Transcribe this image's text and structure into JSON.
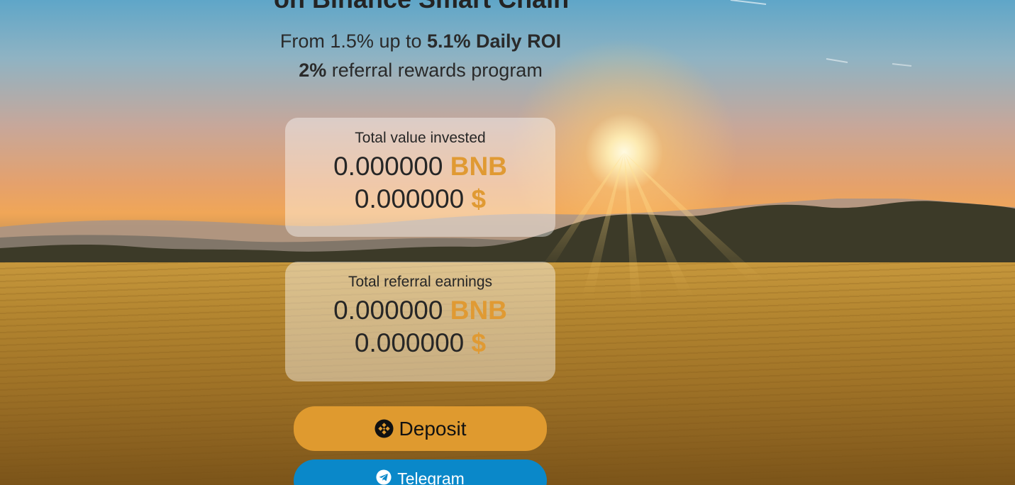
{
  "hero": {
    "headline": "on Binance Smart Chain",
    "line1_prefix": "From 1.5% up to ",
    "line1_bold": "5.1% Daily ROI",
    "line2_bold": "2%",
    "line2_suffix": " referral rewards program"
  },
  "stats": {
    "invested": {
      "title": "Total value invested",
      "bnb_value": "0.000000",
      "bnb_unit": "BNB",
      "usd_value": "0.000000",
      "usd_unit": "$"
    },
    "referral": {
      "title": "Total referral earnings",
      "bnb_value": "0.000000",
      "bnb_unit": "BNB",
      "usd_value": "0.000000",
      "usd_unit": "$"
    }
  },
  "buttons": {
    "deposit_label": "Deposit",
    "deposit_icon": "binance-icon",
    "telegram_label": "Telegram",
    "telegram_icon": "telegram-icon"
  },
  "colors": {
    "accent": "#e09a33",
    "deposit_bg": "#df9a2f",
    "telegram_bg": "#0a88c9"
  }
}
